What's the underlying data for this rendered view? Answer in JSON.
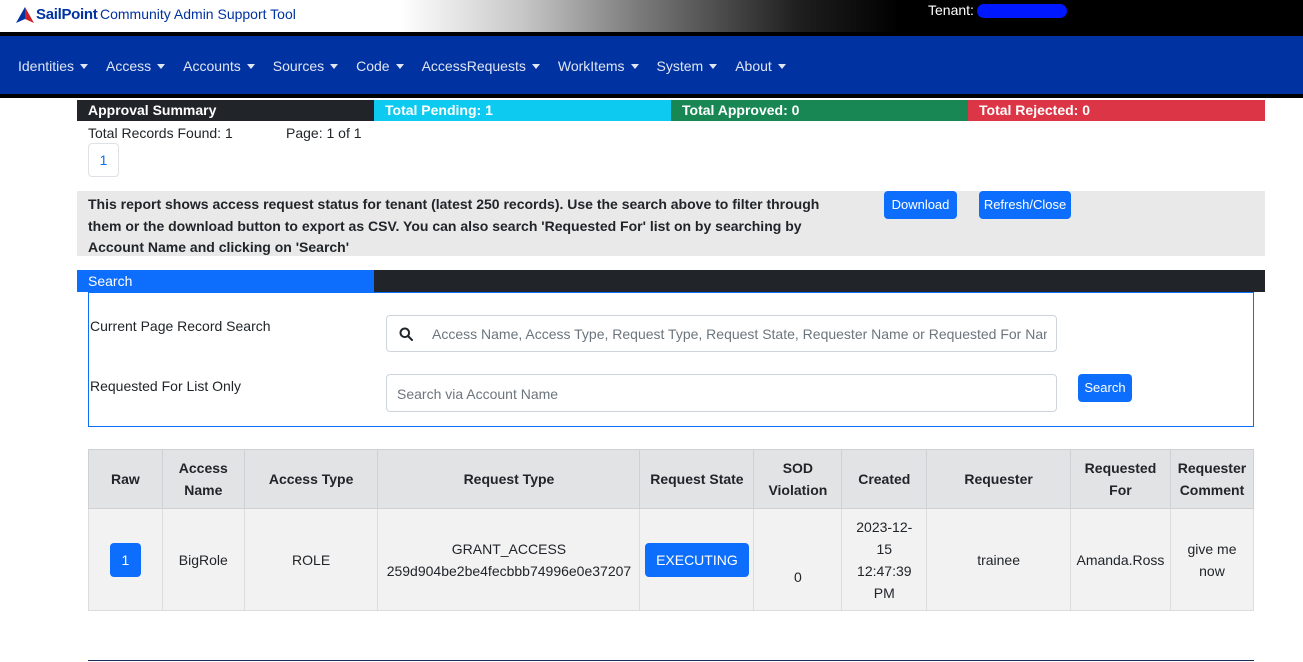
{
  "header": {
    "logo_text": "SailPoint",
    "app_title": "Community Admin Support Tool",
    "tenant_label": "Tenant:"
  },
  "nav": {
    "items": [
      "Identities",
      "Access",
      "Accounts",
      "Sources",
      "Code",
      "AccessRequests",
      "WorkItems",
      "System",
      "About"
    ]
  },
  "summary": {
    "title": "Approval Summary",
    "pending": "Total Pending: 1",
    "approved": "Total Approved: 0",
    "rejected": "Total Rejected: 0"
  },
  "paging": {
    "records": "Total Records Found: 1",
    "page": "Page: 1 of 1",
    "page_button": "1"
  },
  "info": {
    "text": "This report shows access request status for tenant (latest 250 records). Use the search above to filter through them or the download button to export as CSV. You can also search 'Requested For' list on by searching by Account Name and clicking on 'Search'",
    "download_label": "Download",
    "refresh_label": "Refresh/Close"
  },
  "search": {
    "tab_label": "Search",
    "current_label": "Current Page Record Search",
    "current_placeholder": "Access Name, Access Type, Request Type, Request State, Requester Name or Requested For Name",
    "requested_label": "Requested For List Only",
    "requested_placeholder": "Search via Account Name",
    "button_label": "Search"
  },
  "table": {
    "headers": {
      "raw": "Raw",
      "access_name_1": "Access",
      "access_name_2": "Name",
      "access_type": "Access Type",
      "request_type": "Request Type",
      "request_state": "Request State",
      "sod_1": "SOD",
      "sod_2": "Violation",
      "created": "Created",
      "requester": "Requester",
      "requested_for_1": "Requested",
      "requested_for_2": "For",
      "comment_1": "Requester",
      "comment_2": "Comment"
    },
    "rows": [
      {
        "raw": "1",
        "access_name": "BigRole",
        "access_type": "ROLE",
        "request_type_1": "GRANT_ACCESS",
        "request_type_2": "259d904be2be4fecbbb74996e0e37207",
        "request_state": "EXECUTING",
        "sod": "0",
        "created_1": "2023-12-",
        "created_2": "15",
        "created_3": "12:47:39",
        "created_4": "PM",
        "requester": "trainee",
        "requested_for": "Amanda.Ross",
        "comment_1": "give me",
        "comment_2": "now"
      }
    ]
  },
  "colors": {
    "brand": "#0033a1",
    "primary": "#0d6efd",
    "pending": "#0dcaf0",
    "approved": "#198754",
    "rejected": "#dc3545"
  }
}
